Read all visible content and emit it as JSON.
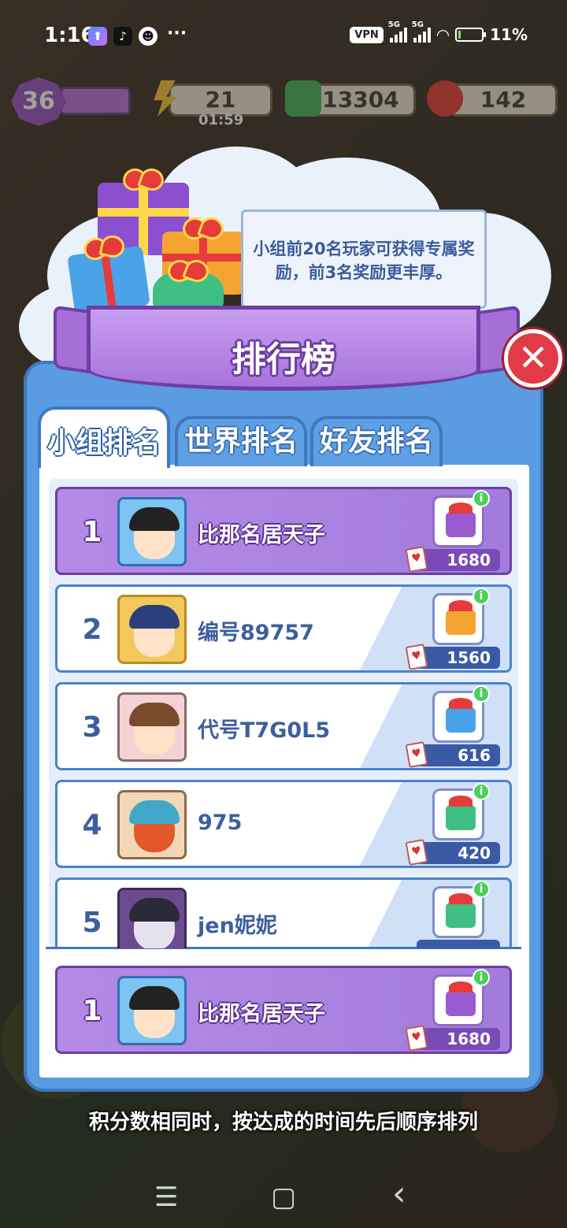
{
  "status_bar": {
    "time": "1:16",
    "dots": "···",
    "vpn": "VPN",
    "signal1_tag": "5G",
    "signal2_tag": "5G",
    "battery": "11%"
  },
  "hud": {
    "level": "36",
    "energy": "21",
    "timer": "01:59",
    "cash": "13304",
    "gems": "142"
  },
  "info_text": "小组前20名玩家可获得专属奖励，前3名奖励更丰厚。",
  "panel": {
    "title": "排行榜",
    "close_label": "✕",
    "tabs": [
      {
        "label": "小组排名",
        "active": true
      },
      {
        "label": "世界排名",
        "active": false
      },
      {
        "label": "好友排名",
        "active": false
      }
    ]
  },
  "rankings": [
    {
      "rank": "1",
      "name": "比那名居天子",
      "score": "1680",
      "highlight": true,
      "gift_color": "#9b5bd0",
      "avatar_bg": "#7cc4f2",
      "hair": "#222222"
    },
    {
      "rank": "2",
      "name": "编号89757",
      "score": "1560",
      "highlight": false,
      "gift_color": "#f5a431",
      "avatar_bg": "#f3c85a",
      "hair": "#2b3f7a"
    },
    {
      "rank": "3",
      "name": "代号T7G0L5",
      "score": "616",
      "highlight": false,
      "gift_color": "#4aa3e8",
      "avatar_bg": "#f3d3d6",
      "hair": "#7a4a2c"
    },
    {
      "rank": "4",
      "name": "975",
      "score": "420",
      "highlight": false,
      "gift_color": "#3fbf84",
      "avatar_bg": "#f0d8b6",
      "hair": "#e2582b"
    },
    {
      "rank": "5",
      "name": "jen妮妮",
      "score": "",
      "highlight": false,
      "gift_color": "#3fbf84",
      "avatar_bg": "#6b4b8e",
      "hair": "#2a2a3a"
    }
  ],
  "my_rank": {
    "rank": "1",
    "name": "比那名居天子",
    "score": "1680"
  },
  "footer_note": "积分数相同时，按达成的时间先后顺序排列",
  "nav": {
    "menu": "☰",
    "home": "▢",
    "back": "‹"
  }
}
